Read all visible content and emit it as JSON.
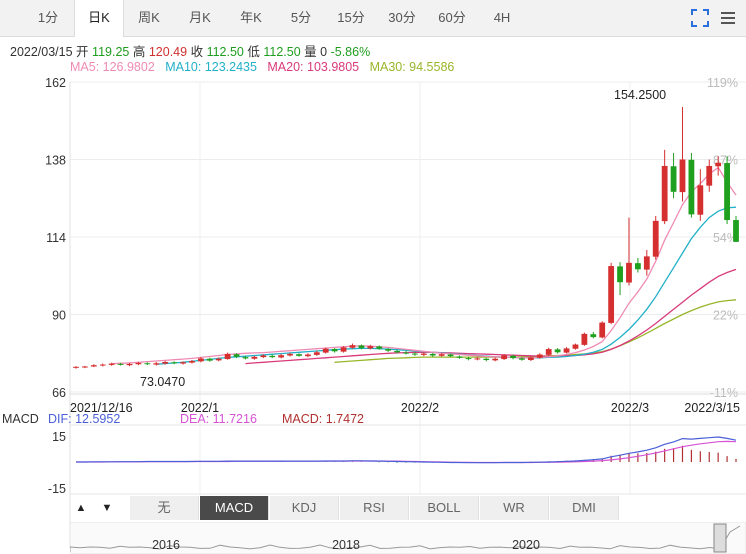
{
  "tabs": [
    "1分",
    "日K",
    "周K",
    "月K",
    "年K",
    "5分",
    "15分",
    "30分",
    "60分",
    "4H"
  ],
  "active_tab": 1,
  "info": {
    "date": "2022/03/15",
    "open_label": "开",
    "open": "119.25",
    "high_label": "高",
    "high": "120.49",
    "close_label": "收",
    "close": "112.50",
    "low_label": "低",
    "low": "112.50",
    "vol_label": "量",
    "vol": "0",
    "change": "-5.86%"
  },
  "ma": {
    "ma5": "MA5: 126.9802",
    "ma10": "MA10: 123.2435",
    "ma20": "MA20: 103.9805",
    "ma30": "MA30: 94.5586"
  },
  "macd": {
    "label": "MACD",
    "dif": "DIF: 12.5952",
    "dea": "DEA: 11.7216",
    "macd": "MACD: 1.7472",
    "y_ticks": [
      "15",
      "-15"
    ]
  },
  "indicator_tabs": [
    "无",
    "MACD",
    "KDJ",
    "RSI",
    "BOLL",
    "WR",
    "DMI"
  ],
  "active_indicator": 1,
  "nav_labels": [
    "2016",
    "2018",
    "2020"
  ],
  "colors": {
    "up": "#d62f2f",
    "down": "#1fa01f",
    "ma5": "#ef8bb3",
    "ma10": "#22b0c8",
    "ma20": "#d83a7a",
    "ma30": "#98b62a",
    "dif": "#4a5fd8",
    "dea": "#d653d6",
    "hist": "#b03030"
  },
  "chart_data": {
    "type": "candlestick",
    "y_ticks": [
      162,
      138,
      114,
      90,
      66
    ],
    "ylim": [
      66,
      162
    ],
    "pct_ticks": [
      "119%",
      "87%",
      "54%",
      "22%",
      "-11%"
    ],
    "x_ticks": [
      "2021/12/16",
      "2022/1",
      "2022/2",
      "2022/3",
      "2022/3/15"
    ],
    "max_label": "154.2500",
    "min_label": "73.0470",
    "candles": [
      [
        73.5,
        73.8,
        73.2,
        74.0
      ],
      [
        73.6,
        73.9,
        73.4,
        74.1
      ],
      [
        73.9,
        74.3,
        73.7,
        74.6
      ],
      [
        74.2,
        74.5,
        73.9,
        74.8
      ],
      [
        74.4,
        74.8,
        74.1,
        75.1
      ],
      [
        74.7,
        74.4,
        74.2,
        75.0
      ],
      [
        74.3,
        74.7,
        74.0,
        75.0
      ],
      [
        74.6,
        75.0,
        74.3,
        75.3
      ],
      [
        74.9,
        74.6,
        74.3,
        75.2
      ],
      [
        74.5,
        74.9,
        74.2,
        75.3
      ],
      [
        74.8,
        75.3,
        74.5,
        75.6
      ],
      [
        75.2,
        74.9,
        74.6,
        75.5
      ],
      [
        74.8,
        75.2,
        74.5,
        75.5
      ],
      [
        75.1,
        75.6,
        74.8,
        75.9
      ],
      [
        75.5,
        76.4,
        75.2,
        76.8
      ],
      [
        76.3,
        75.7,
        75.4,
        76.6
      ],
      [
        75.8,
        76.3,
        75.5,
        76.7
      ],
      [
        76.2,
        77.8,
        76.0,
        78.2
      ],
      [
        77.7,
        76.9,
        76.5,
        78.0
      ],
      [
        76.8,
        76.4,
        76.1,
        77.2
      ],
      [
        76.3,
        76.9,
        76.0,
        77.2
      ],
      [
        76.8,
        77.3,
        76.5,
        77.7
      ],
      [
        77.2,
        76.8,
        76.5,
        77.6
      ],
      [
        76.7,
        77.4,
        76.4,
        77.8
      ],
      [
        77.3,
        77.8,
        77.0,
        78.2
      ],
      [
        77.7,
        77.2,
        76.9,
        78.0
      ],
      [
        77.1,
        77.6,
        76.8,
        78.0
      ],
      [
        77.5,
        78.3,
        77.2,
        78.8
      ],
      [
        78.2,
        79.4,
        77.9,
        79.8
      ],
      [
        79.3,
        78.6,
        78.2,
        79.6
      ],
      [
        78.5,
        79.8,
        78.2,
        80.2
      ],
      [
        79.7,
        80.5,
        79.4,
        81.0
      ],
      [
        80.4,
        79.6,
        79.2,
        80.7
      ],
      [
        79.5,
        80.2,
        79.2,
        80.6
      ],
      [
        80.1,
        79.4,
        79.1,
        80.4
      ],
      [
        79.3,
        78.8,
        78.4,
        79.6
      ],
      [
        78.7,
        78.3,
        77.9,
        79.1
      ],
      [
        78.2,
        78.0,
        77.6,
        78.7
      ],
      [
        77.9,
        77.6,
        77.2,
        78.3
      ],
      [
        77.5,
        77.9,
        77.1,
        78.3
      ],
      [
        77.8,
        77.3,
        76.9,
        78.1
      ],
      [
        77.2,
        77.7,
        76.9,
        78.0
      ],
      [
        77.6,
        77.1,
        76.8,
        77.9
      ],
      [
        77.0,
        76.6,
        76.3,
        77.3
      ],
      [
        76.5,
        76.2,
        75.8,
        76.9
      ],
      [
        76.1,
        76.4,
        75.8,
        76.8
      ],
      [
        76.3,
        75.9,
        75.5,
        76.6
      ],
      [
        75.8,
        76.3,
        75.5,
        76.7
      ],
      [
        76.2,
        77.3,
        75.9,
        77.7
      ],
      [
        77.2,
        76.5,
        76.1,
        77.5
      ],
      [
        76.4,
        76.0,
        75.7,
        76.8
      ],
      [
        75.9,
        76.7,
        75.6,
        77.0
      ],
      [
        76.6,
        77.6,
        76.3,
        78.0
      ],
      [
        77.5,
        79.3,
        77.2,
        79.7
      ],
      [
        79.2,
        78.3,
        77.9,
        79.6
      ],
      [
        78.2,
        79.5,
        77.9,
        79.9
      ],
      [
        79.4,
        80.7,
        79.1,
        81.0
      ],
      [
        80.6,
        84.0,
        80.3,
        84.4
      ],
      [
        83.9,
        83.0,
        82.6,
        84.6
      ],
      [
        82.9,
        87.5,
        82.6,
        87.9
      ],
      [
        87.4,
        105.0,
        87.0,
        106.0
      ],
      [
        104.9,
        100.0,
        96.0,
        106.2
      ],
      [
        99.9,
        106.0,
        99.0,
        120.0
      ],
      [
        105.9,
        104.0,
        103.0,
        107.5
      ],
      [
        103.9,
        108.0,
        102.0,
        110.0
      ],
      [
        107.9,
        119.0,
        107.0,
        120.5
      ],
      [
        118.9,
        136.0,
        118.0,
        141.0
      ],
      [
        135.9,
        128.0,
        126.0,
        140.0
      ],
      [
        127.9,
        138.0,
        125.0,
        154.25
      ],
      [
        137.9,
        121.0,
        120.0,
        140.0
      ],
      [
        120.9,
        130.0,
        119.0,
        135.0
      ],
      [
        129.9,
        136.0,
        128.0,
        138.0
      ],
      [
        135.9,
        137.0,
        133.0,
        139.0
      ],
      [
        136.9,
        119.25,
        118.0,
        139.0
      ],
      [
        119.25,
        112.5,
        112.5,
        120.49
      ]
    ],
    "ma5": [
      null,
      null,
      null,
      null,
      74.8,
      74.9,
      75.0,
      75.2,
      75.4,
      75.6,
      75.8,
      76.0,
      76.2,
      76.4,
      76.7,
      77.0,
      77.3,
      77.6,
      77.8,
      78.0,
      78.1,
      78.2,
      78.4,
      78.6,
      78.8,
      79.0,
      79.2,
      79.4,
      79.6,
      79.8,
      80.0,
      80.2,
      80.3,
      80.2,
      80.0,
      79.8,
      79.5,
      79.2,
      78.9,
      78.6,
      78.3,
      78.0,
      77.8,
      77.6,
      77.4,
      77.2,
      77.0,
      76.9,
      76.8,
      76.7,
      76.6,
      76.6,
      76.7,
      76.9,
      77.2,
      77.6,
      78.2,
      79.0,
      80.1,
      81.6,
      85.0,
      89.0,
      93.5,
      97.0,
      101.0,
      106.5,
      113.0,
      118.5,
      124.0,
      128.0,
      130.5,
      133.5,
      135.5,
      131.0,
      126.98
    ],
    "ma10": [
      null,
      null,
      null,
      null,
      null,
      null,
      null,
      null,
      null,
      74.6,
      74.8,
      75.0,
      75.2,
      75.5,
      75.8,
      76.1,
      76.4,
      76.7,
      76.9,
      77.1,
      77.3,
      77.5,
      77.7,
      77.9,
      78.1,
      78.3,
      78.5,
      78.7,
      78.9,
      79.1,
      79.3,
      79.4,
      79.5,
      79.5,
      79.4,
      79.3,
      79.1,
      78.9,
      78.7,
      78.5,
      78.3,
      78.1,
      77.9,
      77.7,
      77.5,
      77.3,
      77.1,
      76.9,
      76.8,
      76.7,
      76.6,
      76.6,
      76.6,
      76.7,
      76.8,
      77.0,
      77.3,
      77.7,
      78.3,
      79.2,
      80.8,
      82.9,
      85.4,
      88.3,
      91.6,
      95.5,
      100.0,
      104.5,
      109.0,
      113.5,
      117.0,
      120.0,
      122.0,
      123.0,
      123.24
    ],
    "ma20": [
      null,
      null,
      null,
      null,
      null,
      null,
      null,
      null,
      null,
      null,
      null,
      null,
      null,
      null,
      null,
      null,
      null,
      null,
      null,
      74.8,
      75.0,
      75.2,
      75.4,
      75.6,
      75.8,
      76.0,
      76.2,
      76.4,
      76.6,
      76.8,
      77.0,
      77.2,
      77.4,
      77.6,
      77.8,
      78.0,
      78.1,
      78.2,
      78.3,
      78.3,
      78.3,
      78.2,
      78.1,
      78.0,
      77.9,
      77.8,
      77.7,
      77.6,
      77.5,
      77.4,
      77.3,
      77.2,
      77.1,
      77.1,
      77.1,
      77.2,
      77.3,
      77.5,
      77.8,
      78.3,
      79.2,
      80.4,
      81.8,
      83.4,
      85.2,
      87.2,
      89.4,
      91.6,
      93.8,
      96.0,
      98.0,
      100.0,
      101.8,
      103.0,
      103.98
    ],
    "ma30": [
      null,
      null,
      null,
      null,
      null,
      null,
      null,
      null,
      null,
      null,
      null,
      null,
      null,
      null,
      null,
      null,
      null,
      null,
      null,
      null,
      null,
      null,
      null,
      null,
      null,
      null,
      null,
      null,
      null,
      75.2,
      75.4,
      75.6,
      75.8,
      76.0,
      76.2,
      76.4,
      76.5,
      76.6,
      76.7,
      76.8,
      76.8,
      76.8,
      76.8,
      76.8,
      76.8,
      76.8,
      76.8,
      76.8,
      76.8,
      76.8,
      76.9,
      77.0,
      77.1,
      77.2,
      77.3,
      77.4,
      77.6,
      77.8,
      78.1,
      78.5,
      79.3,
      80.3,
      81.5,
      82.8,
      84.2,
      85.7,
      87.2,
      88.6,
      90.0,
      91.2,
      92.3,
      93.2,
      93.9,
      94.3,
      94.56
    ],
    "dif": [
      0,
      0,
      0.1,
      0.1,
      0.1,
      0.2,
      0.2,
      0.2,
      0.3,
      0.3,
      0.3,
      0.3,
      0.3,
      0.3,
      0.4,
      0.4,
      0.4,
      0.5,
      0.5,
      0.5,
      0.5,
      0.5,
      0.5,
      0.5,
      0.5,
      0.5,
      0.5,
      0.5,
      0.6,
      0.6,
      0.6,
      0.7,
      0.7,
      0.6,
      0.5,
      0.4,
      0.3,
      0.2,
      0.1,
      0,
      -0.1,
      -0.2,
      -0.3,
      -0.3,
      -0.4,
      -0.4,
      -0.4,
      -0.4,
      -0.3,
      -0.3,
      -0.3,
      -0.2,
      -0.1,
      0,
      0.2,
      0.4,
      0.6,
      0.9,
      1.3,
      1.8,
      3.0,
      3.9,
      5.0,
      5.8,
      6.8,
      8.2,
      10.2,
      11.6,
      13.5,
      13.2,
      13.6,
      14.0,
      14.4,
      13.6,
      12.6
    ],
    "dea": [
      0,
      0,
      0,
      0,
      0.1,
      0.1,
      0.1,
      0.1,
      0.2,
      0.2,
      0.2,
      0.2,
      0.2,
      0.3,
      0.3,
      0.3,
      0.3,
      0.3,
      0.4,
      0.4,
      0.4,
      0.4,
      0.4,
      0.4,
      0.5,
      0.5,
      0.5,
      0.5,
      0.5,
      0.5,
      0.5,
      0.6,
      0.6,
      0.6,
      0.6,
      0.5,
      0.5,
      0.4,
      0.3,
      0.2,
      0.1,
      0,
      -0.1,
      -0.2,
      -0.2,
      -0.3,
      -0.3,
      -0.3,
      -0.3,
      -0.3,
      -0.3,
      -0.3,
      -0.2,
      -0.2,
      -0.1,
      0,
      0.1,
      0.3,
      0.5,
      0.8,
      1.2,
      1.8,
      2.5,
      3.3,
      4.2,
      5.2,
      6.4,
      7.6,
      8.8,
      9.7,
      10.5,
      11.1,
      11.7,
      11.9,
      11.7
    ]
  }
}
